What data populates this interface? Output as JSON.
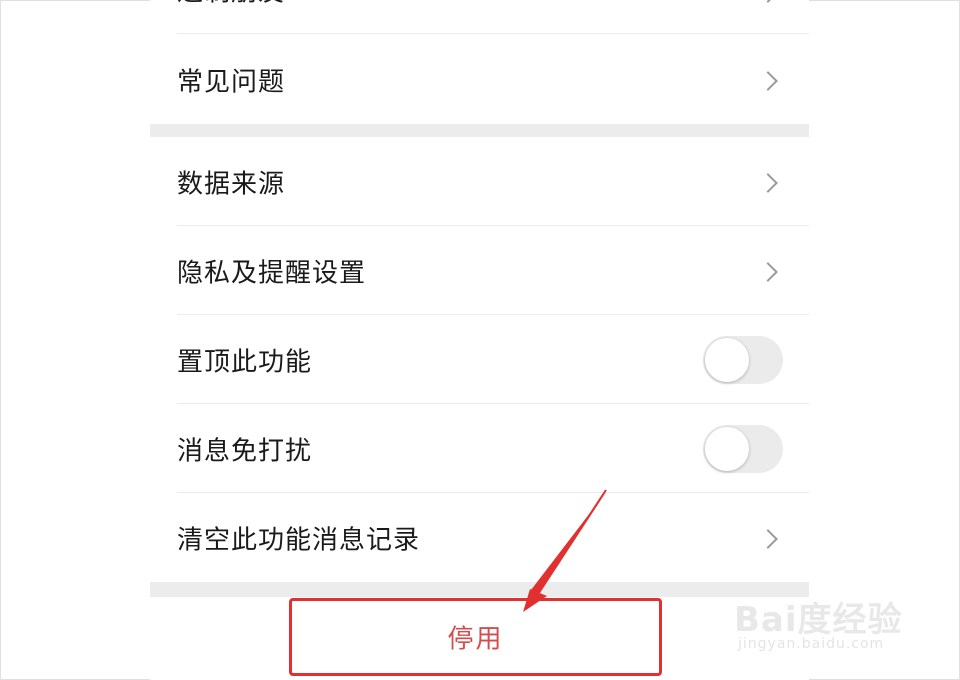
{
  "menu": {
    "partial_item": {
      "label": "进制朋友"
    },
    "items": [
      {
        "label": "常见问题",
        "type": "link"
      },
      {
        "label": "数据来源",
        "type": "link"
      },
      {
        "label": "隐私及提醒设置",
        "type": "link"
      },
      {
        "label": "置顶此功能",
        "type": "toggle",
        "on": false
      },
      {
        "label": "消息免打扰",
        "type": "toggle",
        "on": false
      },
      {
        "label": "清空此功能消息记录",
        "type": "link"
      }
    ]
  },
  "action": {
    "disable_label": "停用"
  },
  "annotation": {
    "color": "#e03030"
  },
  "watermark": {
    "brand": "Bai度经验",
    "url": "jingyan.baidu.com"
  },
  "colors": {
    "accent_red": "#e03030",
    "button_text": "#d64c4c",
    "section_gap": "#ececec"
  }
}
